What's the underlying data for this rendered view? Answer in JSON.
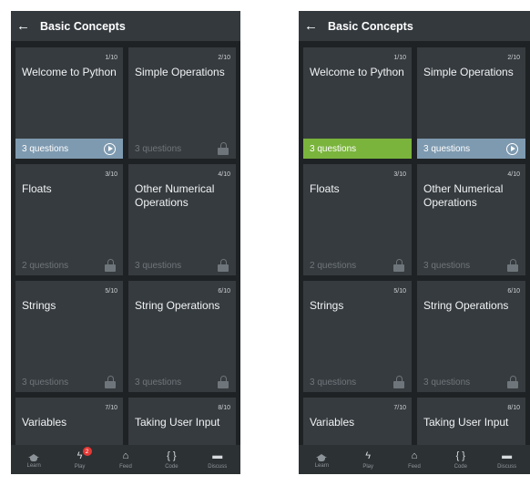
{
  "header": {
    "title": "Basic Concepts",
    "back_icon": "←"
  },
  "cards": [
    {
      "number": "1/10",
      "name": "Welcome to Python",
      "questions": "3 questions"
    },
    {
      "number": "2/10",
      "name": "Simple Operations",
      "questions": "3 questions"
    },
    {
      "number": "3/10",
      "name": "Floats",
      "questions": "2 questions"
    },
    {
      "number": "4/10",
      "name": "Other Numerical Operations",
      "questions": "3 questions"
    },
    {
      "number": "5/10",
      "name": "Strings",
      "questions": "3 questions"
    },
    {
      "number": "6/10",
      "name": "String Operations",
      "questions": "3 questions"
    },
    {
      "number": "7/10",
      "name": "Variables",
      "questions": ""
    },
    {
      "number": "8/10",
      "name": "Taking User Input",
      "questions": ""
    }
  ],
  "nav": {
    "learn": "Learn",
    "play": "Play",
    "play_badge": "2",
    "feed": "Feed",
    "code": "Code",
    "discuss": "Discuss",
    "play_glyph": "ϟ",
    "feed_glyph": "⌂",
    "code_glyph": "{ }",
    "discuss_glyph": "▬"
  },
  "colors": {
    "active_blue": "#7e9ab0",
    "completed_green": "#7ab43c",
    "badge_red": "#e53935",
    "background": "#1f2224"
  }
}
